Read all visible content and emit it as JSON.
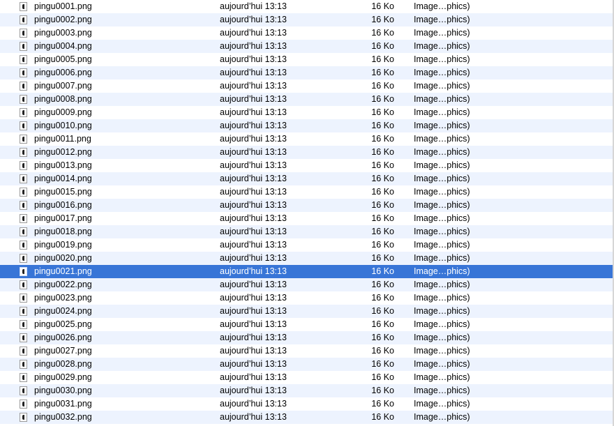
{
  "selected_index": 20,
  "colors": {
    "row_alt": "#edf3fe",
    "row_base": "#ffffff",
    "selection": "#3875d7",
    "selection_text": "#ffffff"
  },
  "files": [
    {
      "name": "pingu0001.png",
      "date": "aujourd’hui 13:13",
      "size": "16 Ko",
      "kind": "Image…phics)",
      "icon": "png-file-icon"
    },
    {
      "name": "pingu0002.png",
      "date": "aujourd’hui 13:13",
      "size": "16 Ko",
      "kind": "Image…phics)",
      "icon": "png-file-icon"
    },
    {
      "name": "pingu0003.png",
      "date": "aujourd’hui 13:13",
      "size": "16 Ko",
      "kind": "Image…phics)",
      "icon": "png-file-icon"
    },
    {
      "name": "pingu0004.png",
      "date": "aujourd’hui 13:13",
      "size": "16 Ko",
      "kind": "Image…phics)",
      "icon": "png-file-icon"
    },
    {
      "name": "pingu0005.png",
      "date": "aujourd’hui 13:13",
      "size": "16 Ko",
      "kind": "Image…phics)",
      "icon": "png-file-icon"
    },
    {
      "name": "pingu0006.png",
      "date": "aujourd’hui 13:13",
      "size": "16 Ko",
      "kind": "Image…phics)",
      "icon": "png-file-icon"
    },
    {
      "name": "pingu0007.png",
      "date": "aujourd’hui 13:13",
      "size": "16 Ko",
      "kind": "Image…phics)",
      "icon": "png-file-icon"
    },
    {
      "name": "pingu0008.png",
      "date": "aujourd’hui 13:13",
      "size": "16 Ko",
      "kind": "Image…phics)",
      "icon": "png-file-icon"
    },
    {
      "name": "pingu0009.png",
      "date": "aujourd’hui 13:13",
      "size": "16 Ko",
      "kind": "Image…phics)",
      "icon": "png-file-icon"
    },
    {
      "name": "pingu0010.png",
      "date": "aujourd’hui 13:13",
      "size": "16 Ko",
      "kind": "Image…phics)",
      "icon": "png-file-icon"
    },
    {
      "name": "pingu0011.png",
      "date": "aujourd’hui 13:13",
      "size": "16 Ko",
      "kind": "Image…phics)",
      "icon": "png-file-icon"
    },
    {
      "name": "pingu0012.png",
      "date": "aujourd’hui 13:13",
      "size": "16 Ko",
      "kind": "Image…phics)",
      "icon": "png-file-icon"
    },
    {
      "name": "pingu0013.png",
      "date": "aujourd’hui 13:13",
      "size": "16 Ko",
      "kind": "Image…phics)",
      "icon": "png-file-icon"
    },
    {
      "name": "pingu0014.png",
      "date": "aujourd’hui 13:13",
      "size": "16 Ko",
      "kind": "Image…phics)",
      "icon": "png-file-icon"
    },
    {
      "name": "pingu0015.png",
      "date": "aujourd’hui 13:13",
      "size": "16 Ko",
      "kind": "Image…phics)",
      "icon": "png-file-icon"
    },
    {
      "name": "pingu0016.png",
      "date": "aujourd’hui 13:13",
      "size": "16 Ko",
      "kind": "Image…phics)",
      "icon": "png-file-icon"
    },
    {
      "name": "pingu0017.png",
      "date": "aujourd’hui 13:13",
      "size": "16 Ko",
      "kind": "Image…phics)",
      "icon": "png-file-icon"
    },
    {
      "name": "pingu0018.png",
      "date": "aujourd’hui 13:13",
      "size": "16 Ko",
      "kind": "Image…phics)",
      "icon": "png-file-icon"
    },
    {
      "name": "pingu0019.png",
      "date": "aujourd’hui 13:13",
      "size": "16 Ko",
      "kind": "Image…phics)",
      "icon": "png-file-icon"
    },
    {
      "name": "pingu0020.png",
      "date": "aujourd’hui 13:13",
      "size": "16 Ko",
      "kind": "Image…phics)",
      "icon": "png-file-icon"
    },
    {
      "name": "pingu0021.png",
      "date": "aujourd’hui 13:13",
      "size": "16 Ko",
      "kind": "Image…phics)",
      "icon": "png-file-icon"
    },
    {
      "name": "pingu0022.png",
      "date": "aujourd’hui 13:13",
      "size": "16 Ko",
      "kind": "Image…phics)",
      "icon": "png-file-icon"
    },
    {
      "name": "pingu0023.png",
      "date": "aujourd’hui 13:13",
      "size": "16 Ko",
      "kind": "Image…phics)",
      "icon": "png-file-icon"
    },
    {
      "name": "pingu0024.png",
      "date": "aujourd’hui 13:13",
      "size": "16 Ko",
      "kind": "Image…phics)",
      "icon": "png-file-icon"
    },
    {
      "name": "pingu0025.png",
      "date": "aujourd’hui 13:13",
      "size": "16 Ko",
      "kind": "Image…phics)",
      "icon": "png-file-icon"
    },
    {
      "name": "pingu0026.png",
      "date": "aujourd’hui 13:13",
      "size": "16 Ko",
      "kind": "Image…phics)",
      "icon": "png-file-icon"
    },
    {
      "name": "pingu0027.png",
      "date": "aujourd’hui 13:13",
      "size": "16 Ko",
      "kind": "Image…phics)",
      "icon": "png-file-icon"
    },
    {
      "name": "pingu0028.png",
      "date": "aujourd’hui 13:13",
      "size": "16 Ko",
      "kind": "Image…phics)",
      "icon": "png-file-icon"
    },
    {
      "name": "pingu0029.png",
      "date": "aujourd’hui 13:13",
      "size": "16 Ko",
      "kind": "Image…phics)",
      "icon": "png-file-icon"
    },
    {
      "name": "pingu0030.png",
      "date": "aujourd’hui 13:13",
      "size": "16 Ko",
      "kind": "Image…phics)",
      "icon": "png-file-icon"
    },
    {
      "name": "pingu0031.png",
      "date": "aujourd’hui 13:13",
      "size": "16 Ko",
      "kind": "Image…phics)",
      "icon": "png-file-icon"
    },
    {
      "name": "pingu0032.png",
      "date": "aujourd’hui 13:13",
      "size": "16 Ko",
      "kind": "Image…phics)",
      "icon": "png-file-icon"
    }
  ]
}
